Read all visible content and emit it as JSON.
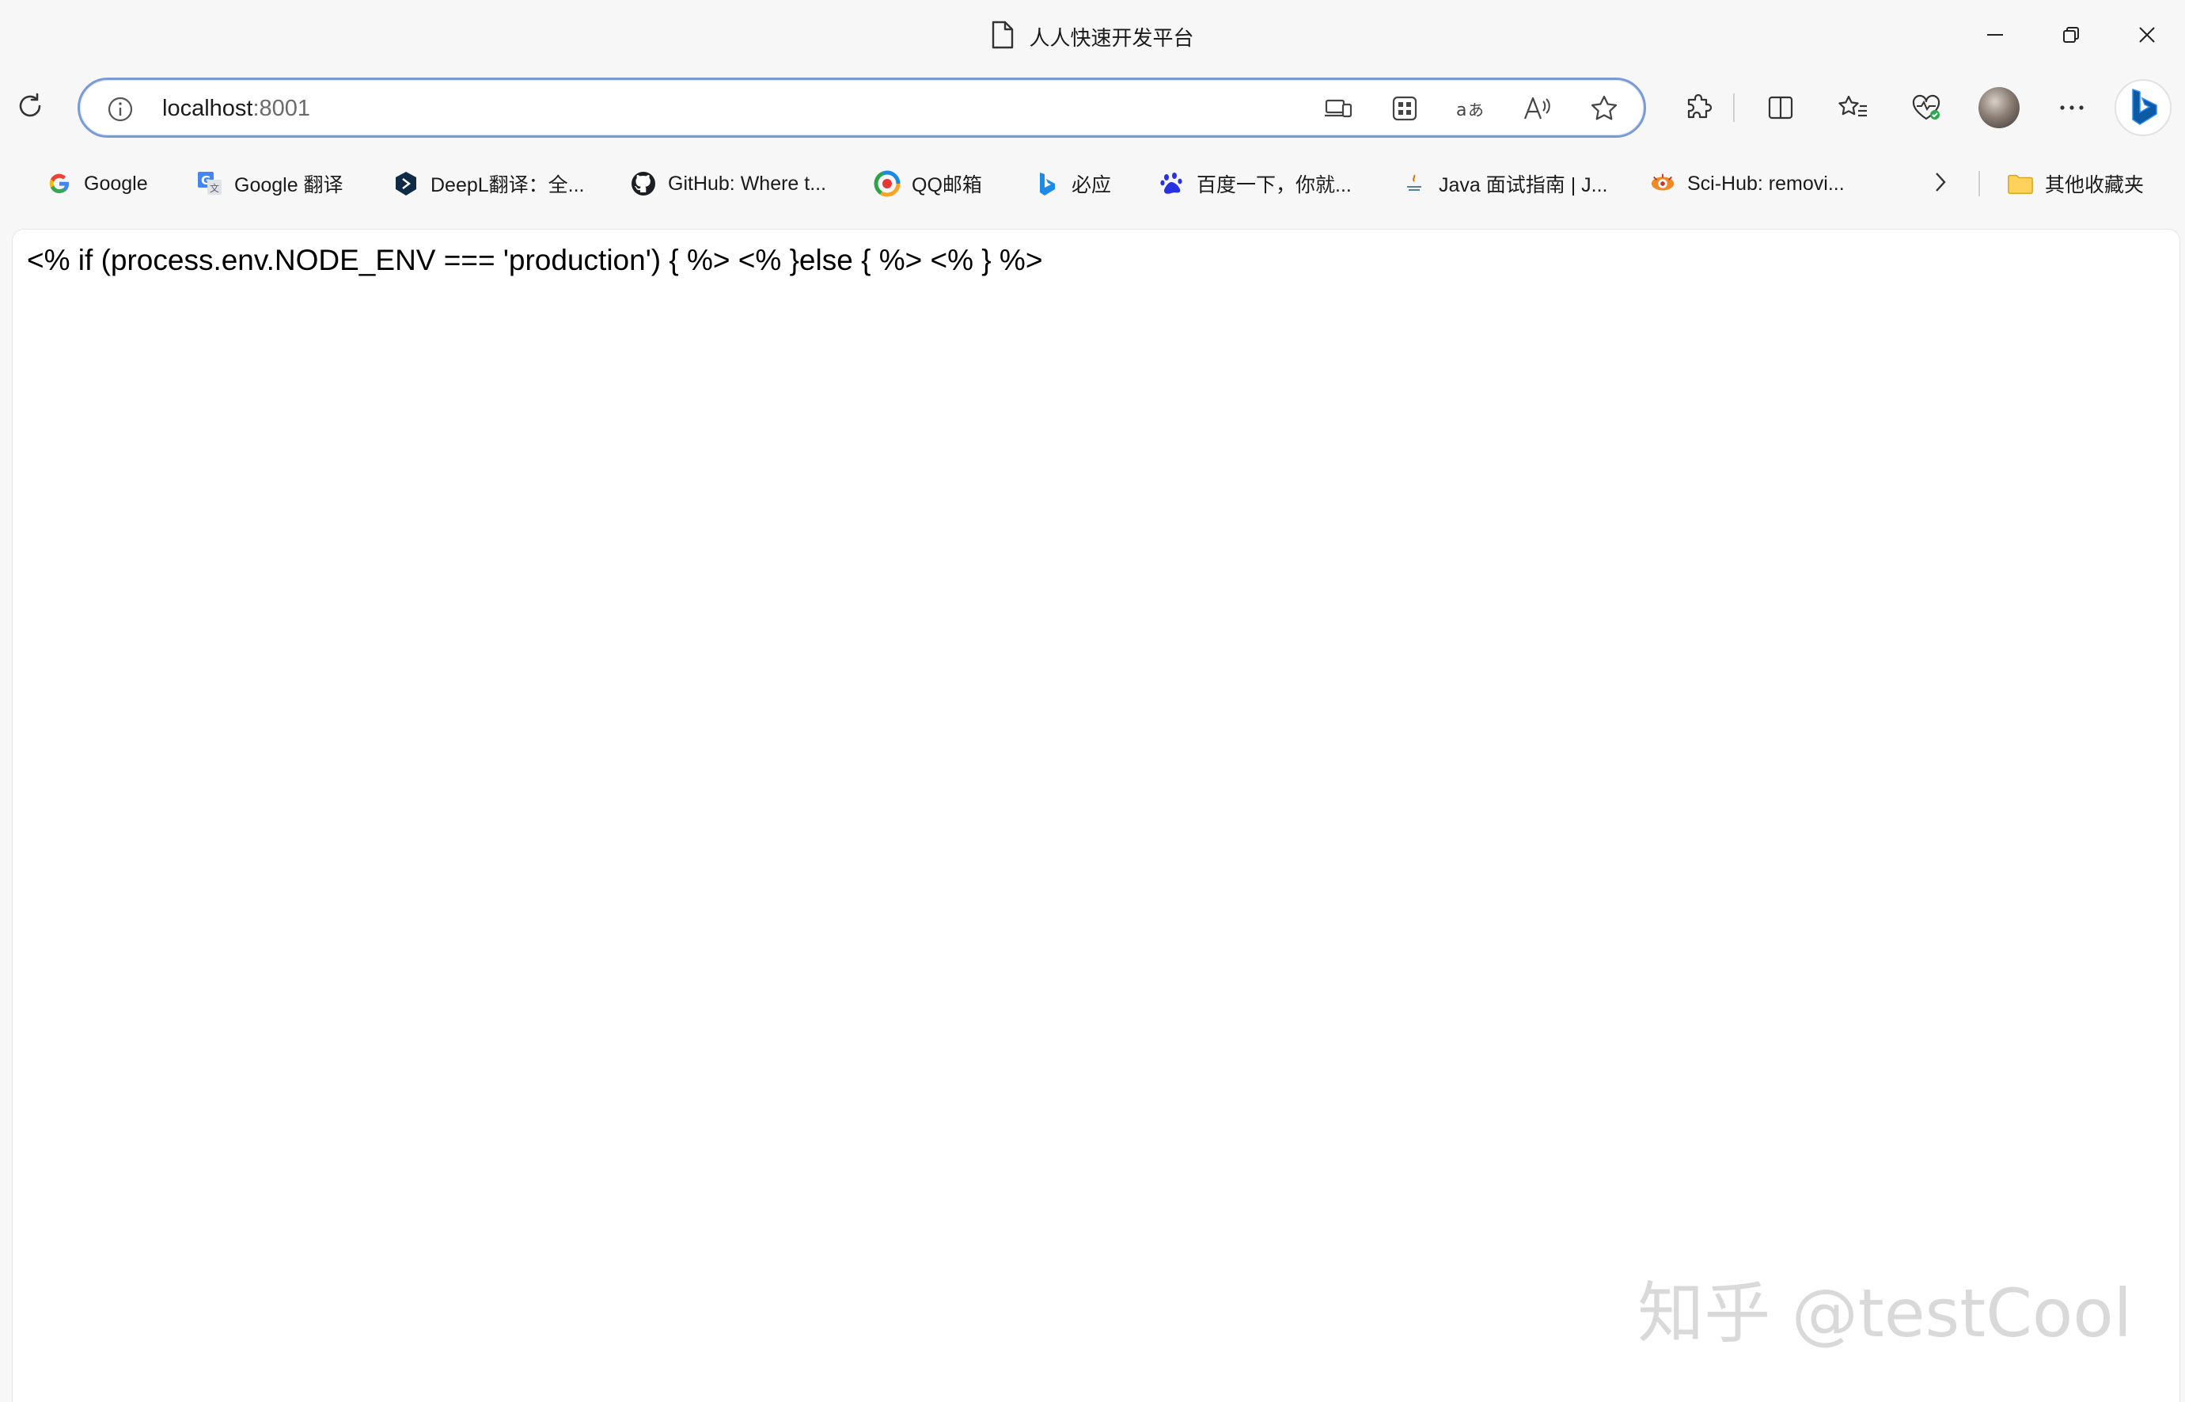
{
  "window": {
    "title": "人人快速开发平台",
    "controls": [
      "minimize-icon",
      "restore-icon",
      "close-icon"
    ]
  },
  "toolbar": {
    "address": {
      "host": "localhost",
      "port": ":8001"
    },
    "address_actions": [
      "device-icon",
      "apps-grid-icon",
      "translate-icon",
      "read-aloud-icon",
      "favorite-star-icon"
    ],
    "right_tools": [
      "extensions-icon",
      "split-screen-icon",
      "favorites-icon",
      "browser-essentials-icon",
      "profile-avatar",
      "more-icon"
    ],
    "copilot": "bing-icon"
  },
  "bookmarks": [
    {
      "label": "Google",
      "icon": "google-icon"
    },
    {
      "label": "Google 翻译",
      "icon": "google-translate-icon"
    },
    {
      "label": "DeepL翻译：全...",
      "icon": "deepl-icon"
    },
    {
      "label": "GitHub: Where t...",
      "icon": "github-icon"
    },
    {
      "label": "QQ邮箱",
      "icon": "qq-mail-icon"
    },
    {
      "label": "必应",
      "icon": "bing-icon"
    },
    {
      "label": "百度一下，你就...",
      "icon": "baidu-icon"
    },
    {
      "label": "Java 面试指南 | J...",
      "icon": "java-guide-icon"
    },
    {
      "label": "Sci-Hub: removi...",
      "icon": "scihub-icon"
    }
  ],
  "other_bookmarks": "其他收藏夹",
  "page": {
    "body_text": "<% if (process.env.NODE_ENV === 'production') { %> <% }else { %> <% } %>",
    "watermark": "知乎 @testCool"
  },
  "colors": {
    "accent": "#0c59a4",
    "address_border": "#7a9ad6",
    "content_bg": "#ffffff",
    "chrome_bg": "#f7f7f7"
  }
}
